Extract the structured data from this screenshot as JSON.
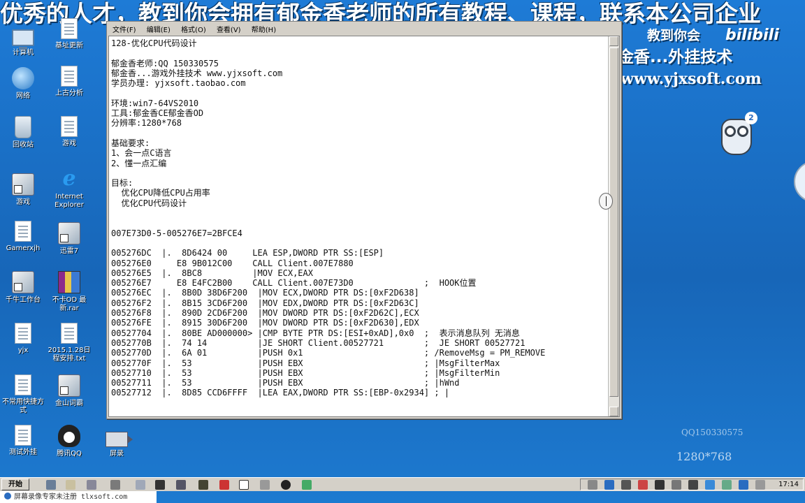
{
  "banner": {
    "text": "优秀的人才，教到你会拥有郁金香老师的所有教程、课程，联系本公司企业"
  },
  "desktop_icons": [
    {
      "label": "计算机",
      "icon": "computer-icon"
    },
    {
      "label": "基址更新",
      "icon": "document-icon"
    },
    {
      "label": "网络",
      "icon": "network-icon"
    },
    {
      "label": "上古分析",
      "icon": "document-icon"
    },
    {
      "label": "回收站",
      "icon": "recycle-bin-icon"
    },
    {
      "label": "游戏",
      "icon": "document-icon"
    },
    {
      "label": "游戏",
      "icon": "app-icon"
    },
    {
      "label": "Internet Explorer",
      "icon": "ie-icon"
    },
    {
      "label": "Gamerxjh",
      "icon": "document-icon"
    },
    {
      "label": "迅雷7",
      "icon": "app-icon"
    },
    {
      "label": "千牛工作台",
      "icon": "app-icon"
    },
    {
      "label": "不卡OD 最新.rar",
      "icon": "archive-icon"
    },
    {
      "label": "yjx",
      "icon": "document-icon"
    },
    {
      "label": "2015.1.28日程安排.txt",
      "icon": "document-icon"
    },
    {
      "label": "不常用快捷方式",
      "icon": "document-icon"
    },
    {
      "label": "金山词霸",
      "icon": "app-icon"
    },
    {
      "label": "测试外挂",
      "icon": "document-icon"
    },
    {
      "label": "腾讯QQ",
      "icon": "qq-icon"
    },
    {
      "label": "屏录",
      "icon": "camera-icon"
    }
  ],
  "watermark": {
    "line1": "教到你会",
    "bili": "bilibili",
    "line2": "金香...外挂技术",
    "site": "www.yjxsoft.com",
    "qq": "QQ150330575",
    "resolution": "1280*768",
    "badge": "2"
  },
  "notepad": {
    "menu": [
      "文件(F)",
      "编辑(E)",
      "格式(O)",
      "查看(V)",
      "帮助(H)"
    ],
    "lines": [
      "128-优化CPU代码设计",
      "",
      "郁金香老师:QQ 150330575",
      "郁金香...游戏外挂技术 www.yjxsoft.com",
      "学员办理: yjxsoft.taobao.com",
      "",
      "环境:win7-64VS2010",
      "工具:郁金香CE郁金香OD",
      "分辨率:1280*768",
      "",
      "基础要求:",
      "1、会一点C语言",
      "2、懂一点汇编",
      "",
      "目标:",
      "  优化CPU降低CPU占用率",
      "  优化CPU代码设计",
      "",
      "",
      "007E73D0-5-005276E7=2BFCE4",
      "",
      "005276DC  |.  8D6424 00     LEA ESP,DWORD PTR SS:[ESP]",
      "005276E0     E8 9B012C00    CALL Client.007E7880",
      "005276E5  |.  8BC8          |MOV ECX,EAX",
      "005276E7     E8 E4FC2B00    CALL Client.007E73D0              ;  HOOK位置",
      "005276EC  |.  8B0D 38D6F200  |MOV ECX,DWORD PTR DS:[0xF2D638]",
      "005276F2  |.  8B15 3CD6F200  |MOV EDX,DWORD PTR DS:[0xF2D63C]",
      "005276F8  |.  890D 2CD6F200  |MOV DWORD PTR DS:[0xF2D62C],ECX",
      "005276FE  |.  8915 30D6F200  |MOV DWORD PTR DS:[0xF2D630],EDX",
      "00527704  |.  80BE AD000000> |CMP BYTE PTR DS:[ESI+0xAD],0x0  ;  表示消息队列 无消息",
      "0052770B  |.  74 14          |JE SHORT Client.00527721        ;  JE SHORT 00527721",
      "0052770D  |.  6A 01          |PUSH 0x1                        ; /RemoveMsg = PM_REMOVE",
      "0052770F  |.  53             |PUSH EBX                        ; |MsgFilterMax",
      "00527710  |.  53             |PUSH EBX                        ; |MsgFilterMin",
      "00527711  |.  53             |PUSH EBX                        ; |hWnd",
      "00527712  |.  8D85 CCD6FFFF  |LEA EAX,DWORD PTR SS:[EBP-0x2934] ; |"
    ]
  },
  "taskbar": {
    "start_label": "开始",
    "clock": "17:14",
    "status_text": "屏幕录像专家未注册 tlxsoft.com"
  }
}
